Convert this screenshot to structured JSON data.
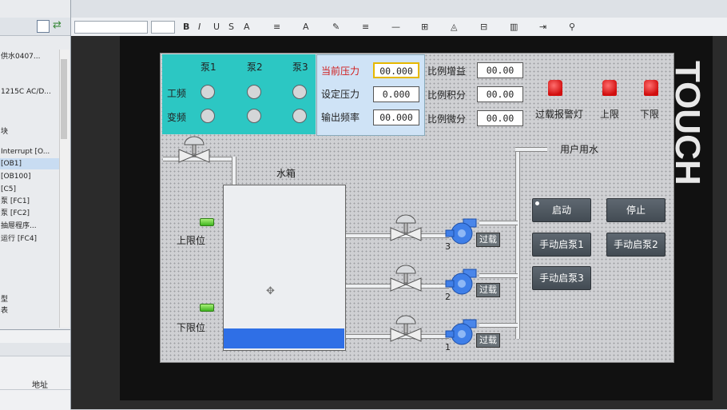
{
  "tree": {
    "items": [
      "供水0407...",
      "",
      "1215C AC/D...",
      "",
      "",
      "块",
      "Interrupt [O...",
      "[OB1]",
      "[OB100]",
      "[C5]",
      "泵 [FC1]",
      "泵 [FC2]",
      "抽屉程序...",
      "运行 [FC4]",
      "",
      "",
      "",
      "",
      "型",
      "表"
    ],
    "bottom_col": "地址"
  },
  "toolbar": {
    "buttons": [
      "B",
      "I",
      "U",
      "S",
      "A",
      "≡",
      "A",
      "✎",
      "≡",
      "—",
      "⊞",
      "◬",
      "⊟",
      "▥",
      "⇥",
      "⚲"
    ]
  },
  "pump_panel": {
    "col_headers": [
      "泵1",
      "泵2",
      "泵3"
    ],
    "row_labels": [
      "工频",
      "变频"
    ]
  },
  "press_panel": {
    "rows": [
      {
        "label": "当前压力",
        "value": "00.000",
        "highlight": true
      },
      {
        "label": "设定压力",
        "value": "0.000",
        "highlight": false
      },
      {
        "label": "输出频率",
        "value": "00.000",
        "highlight": false
      }
    ]
  },
  "pid": [
    {
      "label": "比例增益",
      "value": "00.00"
    },
    {
      "label": "比例积分",
      "value": "00.00"
    },
    {
      "label": "比例微分",
      "value": "00.00"
    }
  ],
  "alarms": [
    "过载报警灯",
    "上限",
    "下限"
  ],
  "water": {
    "tank_label": "水箱",
    "user_label": "用户用水",
    "upper_label": "上限位",
    "lower_label": "下限位",
    "tank_level_fraction": 0.12
  },
  "pumps": [
    {
      "number": "3",
      "overload": "过载"
    },
    {
      "number": "2",
      "overload": "过载"
    },
    {
      "number": "1",
      "overload": "过载"
    }
  ],
  "buttons": {
    "start": "启动",
    "stop": "停止",
    "manual1": "手动启泵1",
    "manual2": "手动启泵2",
    "manual3": "手动启泵3"
  },
  "brand": "TOUCH",
  "colors": {
    "pump_panel": "#2cc7c3",
    "tank_water": "#2f6fe6",
    "pump_blue": "#3f7fe8",
    "alarm_red": "#d10e0e"
  }
}
